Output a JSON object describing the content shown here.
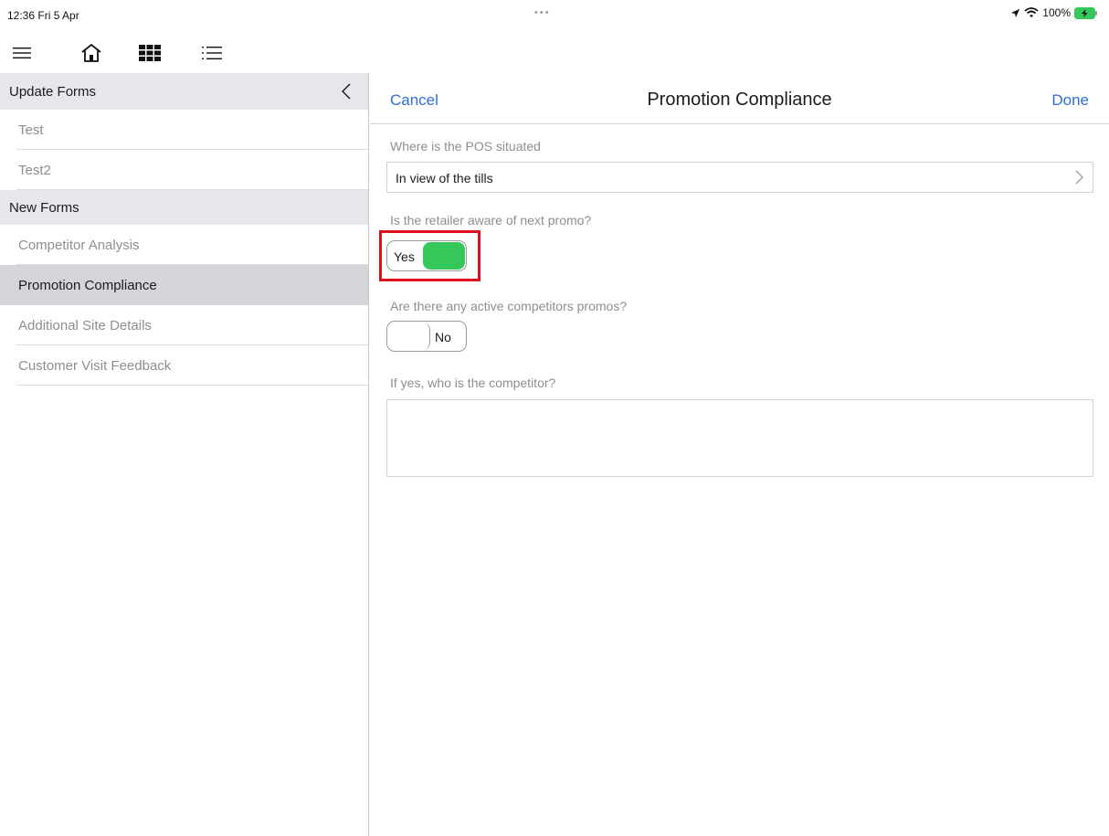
{
  "status_bar": {
    "time": "12:36  Fri 5 Apr",
    "dots": "•••",
    "battery_text": "100%"
  },
  "toolbar": {
    "icons": [
      "menu-icon",
      "home-icon",
      "grid-icon",
      "list-icon"
    ]
  },
  "sidebar": {
    "update_section": "Update Forms",
    "update_items": [
      {
        "label": "Test"
      },
      {
        "label": "Test2"
      }
    ],
    "new_section": "New Forms",
    "new_items": [
      {
        "label": "Competitor Analysis",
        "selected": false
      },
      {
        "label": "Promotion Compliance",
        "selected": true
      },
      {
        "label": "Additional Site Details",
        "selected": false
      },
      {
        "label": "Customer Visit Feedback",
        "selected": false
      }
    ]
  },
  "form": {
    "cancel": "Cancel",
    "title": "Promotion Compliance",
    "done": "Done",
    "q1": {
      "label": "Where is the POS situated",
      "value": "In view of the tills"
    },
    "q2": {
      "label": "Is the retailer aware of next promo?",
      "value": "Yes"
    },
    "q3": {
      "label": "Are there any active competitors promos?",
      "value": "No"
    },
    "q4": {
      "label": "If yes, who is the competitor?",
      "value": ""
    }
  },
  "colors": {
    "accent": "#2f6fd6",
    "toggle_on": "#34c759",
    "highlight": "#e0101a",
    "selected_row": "#d4d4d9",
    "section_bg": "#e6e6ec"
  }
}
